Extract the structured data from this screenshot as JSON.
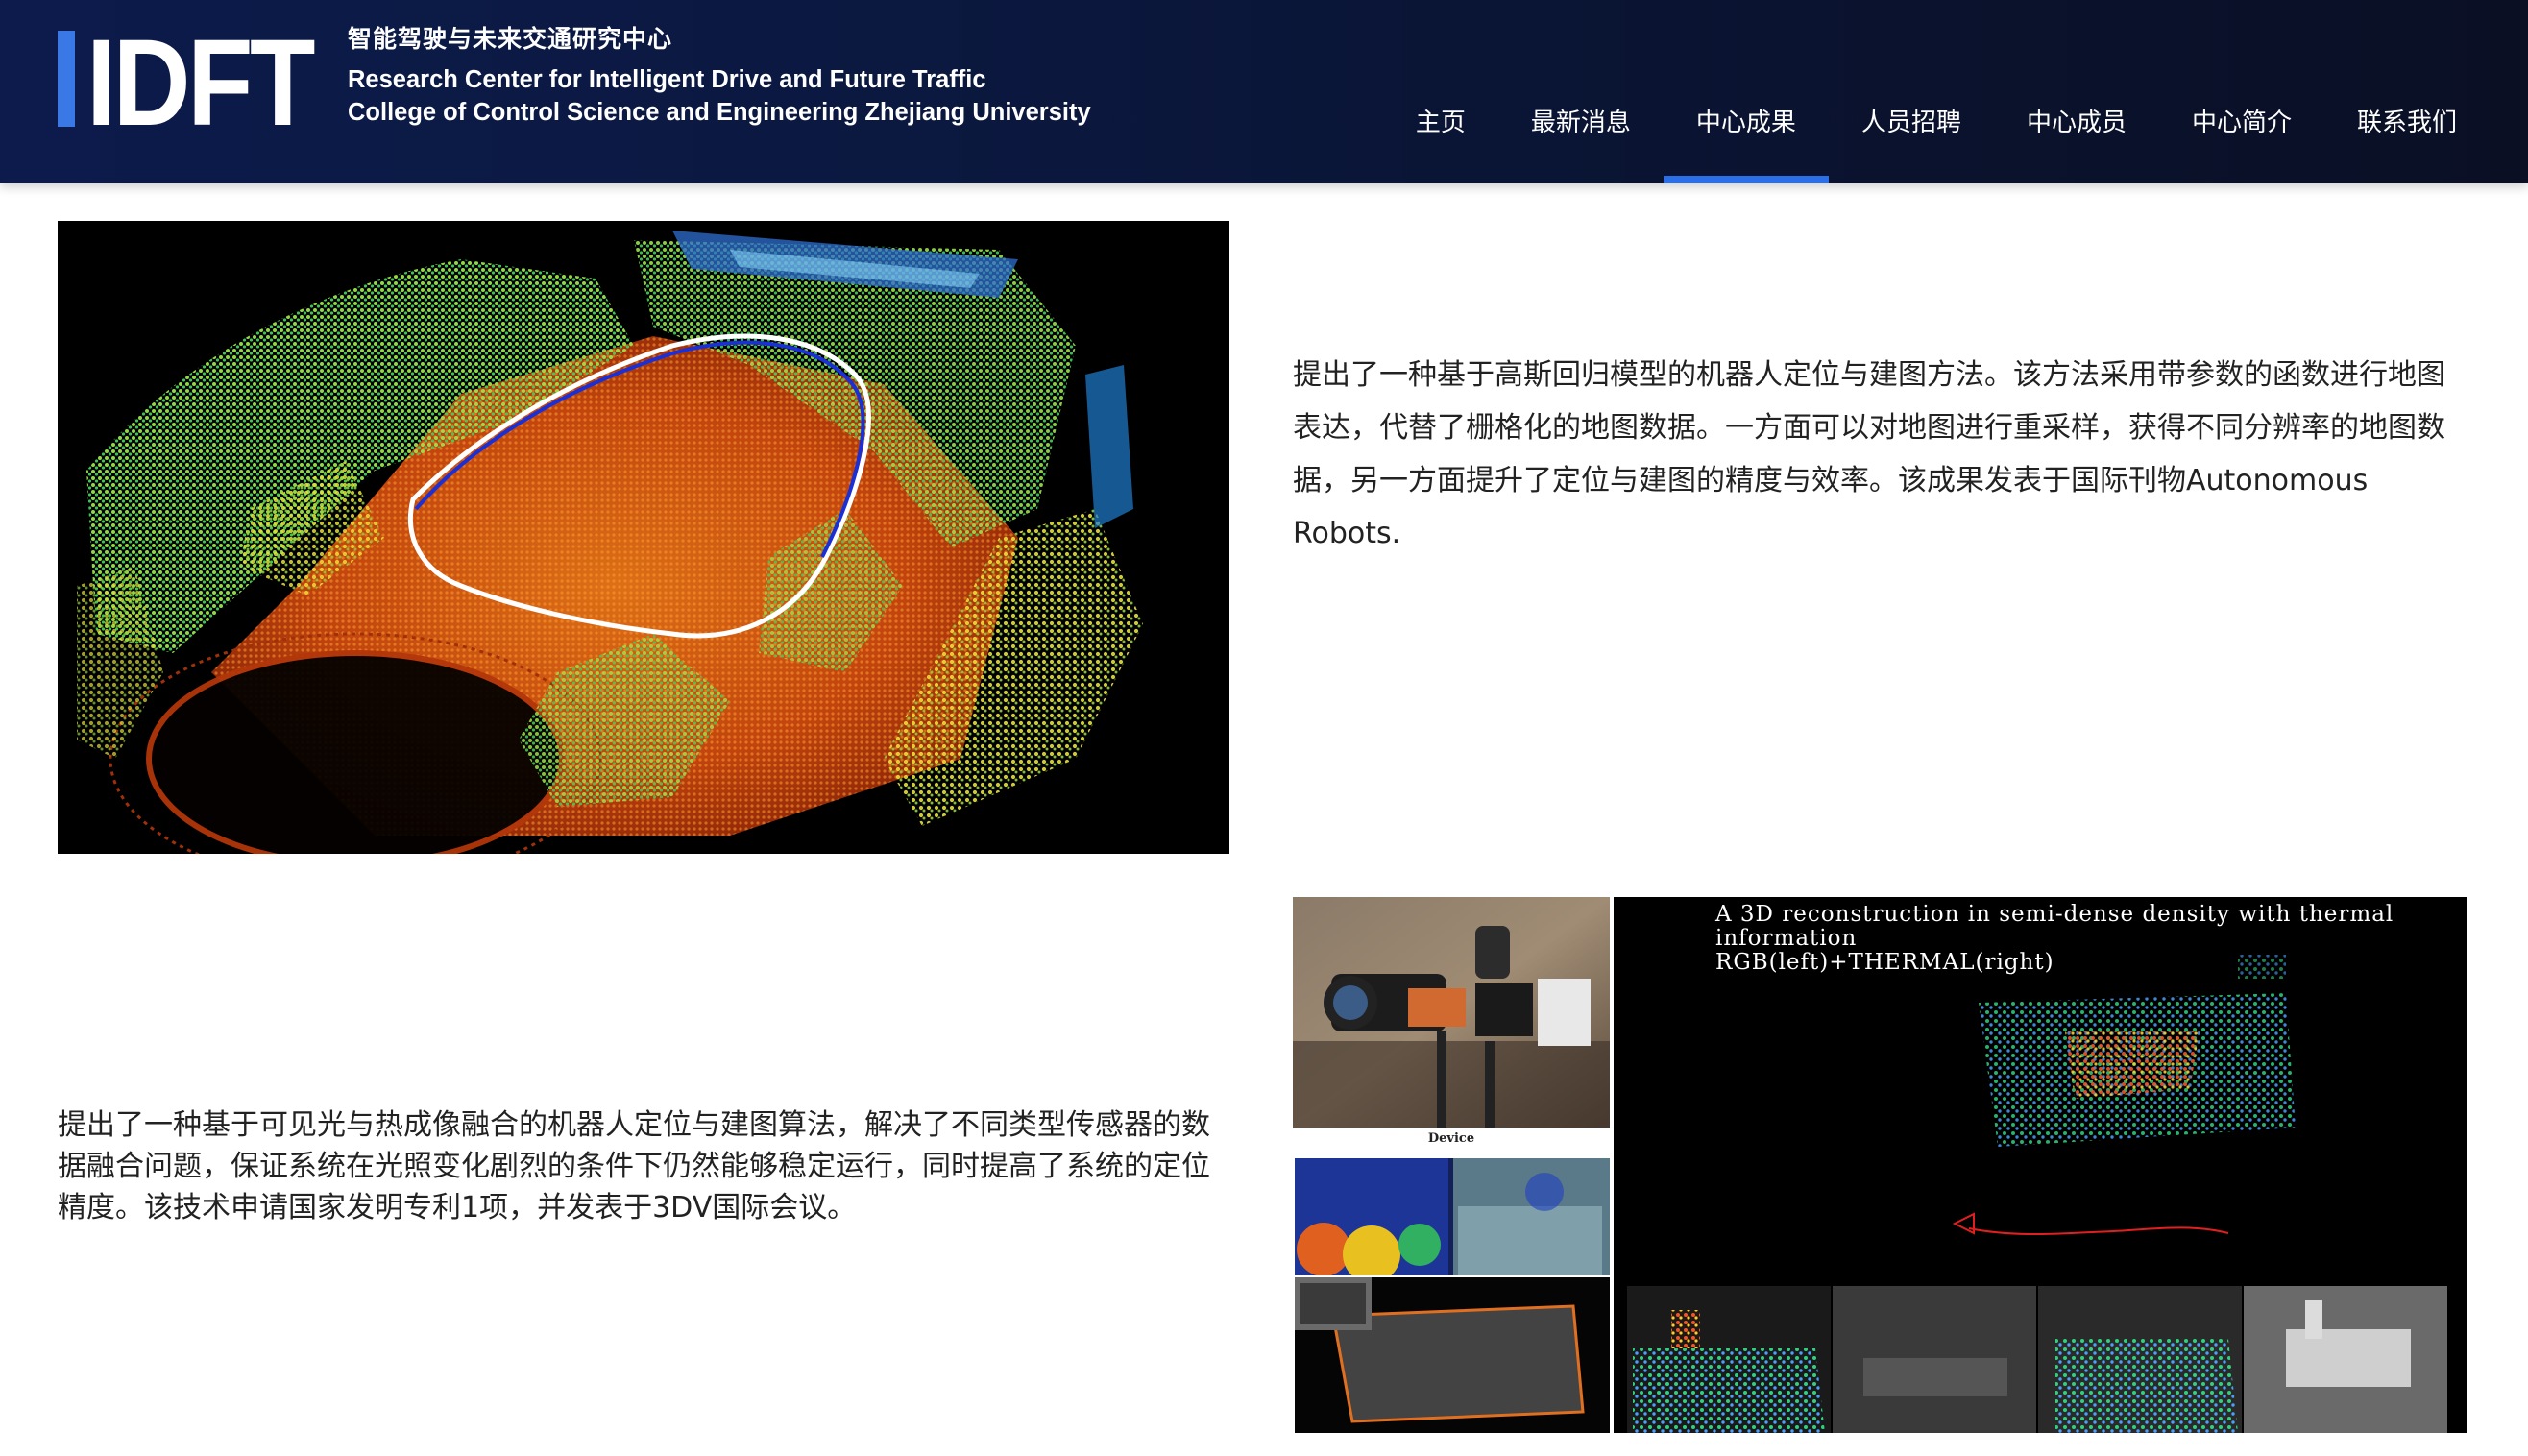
{
  "header": {
    "logo_mark_text": "IDFT",
    "logo_cn": "智能驾驶与未来交通研究中心",
    "logo_en_line1": "Research Center for Intelligent Drive and Future Traffic",
    "logo_en_line2": "College of Control Science and Engineering Zhejiang University"
  },
  "nav": {
    "items": [
      {
        "label": "主页"
      },
      {
        "label": "最新消息"
      },
      {
        "label": "中心成果",
        "active": true
      },
      {
        "label": "人员招聘"
      },
      {
        "label": "中心成员"
      },
      {
        "label": "中心简介"
      },
      {
        "label": "联系我们"
      }
    ]
  },
  "sections": [
    {
      "text": "提出了一种基于高斯回归模型的机器人定位与建图方法。该方法采用带参数的函数进行地图表达，代替了栅格化的地图数据。一方面可以对地图进行重采样，获得不同分辨率的地图数据，另一方面提升了定位与建图的精度与效率。该成果发表于国际刊物Autonomous Robots."
    },
    {
      "text": "提出了一种基于可见光与热成像融合的机器人定位与建图算法，解决了不同类型传感器的数据融合问题，保证系统在光照变化剧烈的条件下仍然能够稳定运行，同时提高了系统的定位精度。该技术申请国家发明专利1项，并发表于3DV国际会议。",
      "figure": {
        "device_caption": "Device",
        "recon_title_line1": "A 3D reconstruction in semi-dense density with thermal",
        "recon_title_line2": "information",
        "recon_title_line3": "RGB(left)+THERMAL(right)"
      }
    }
  ],
  "colors": {
    "header_bg": "#0b1840",
    "accent": "#2a6ee8",
    "logo_blue": "#3a78e6",
    "text": "#222222"
  }
}
